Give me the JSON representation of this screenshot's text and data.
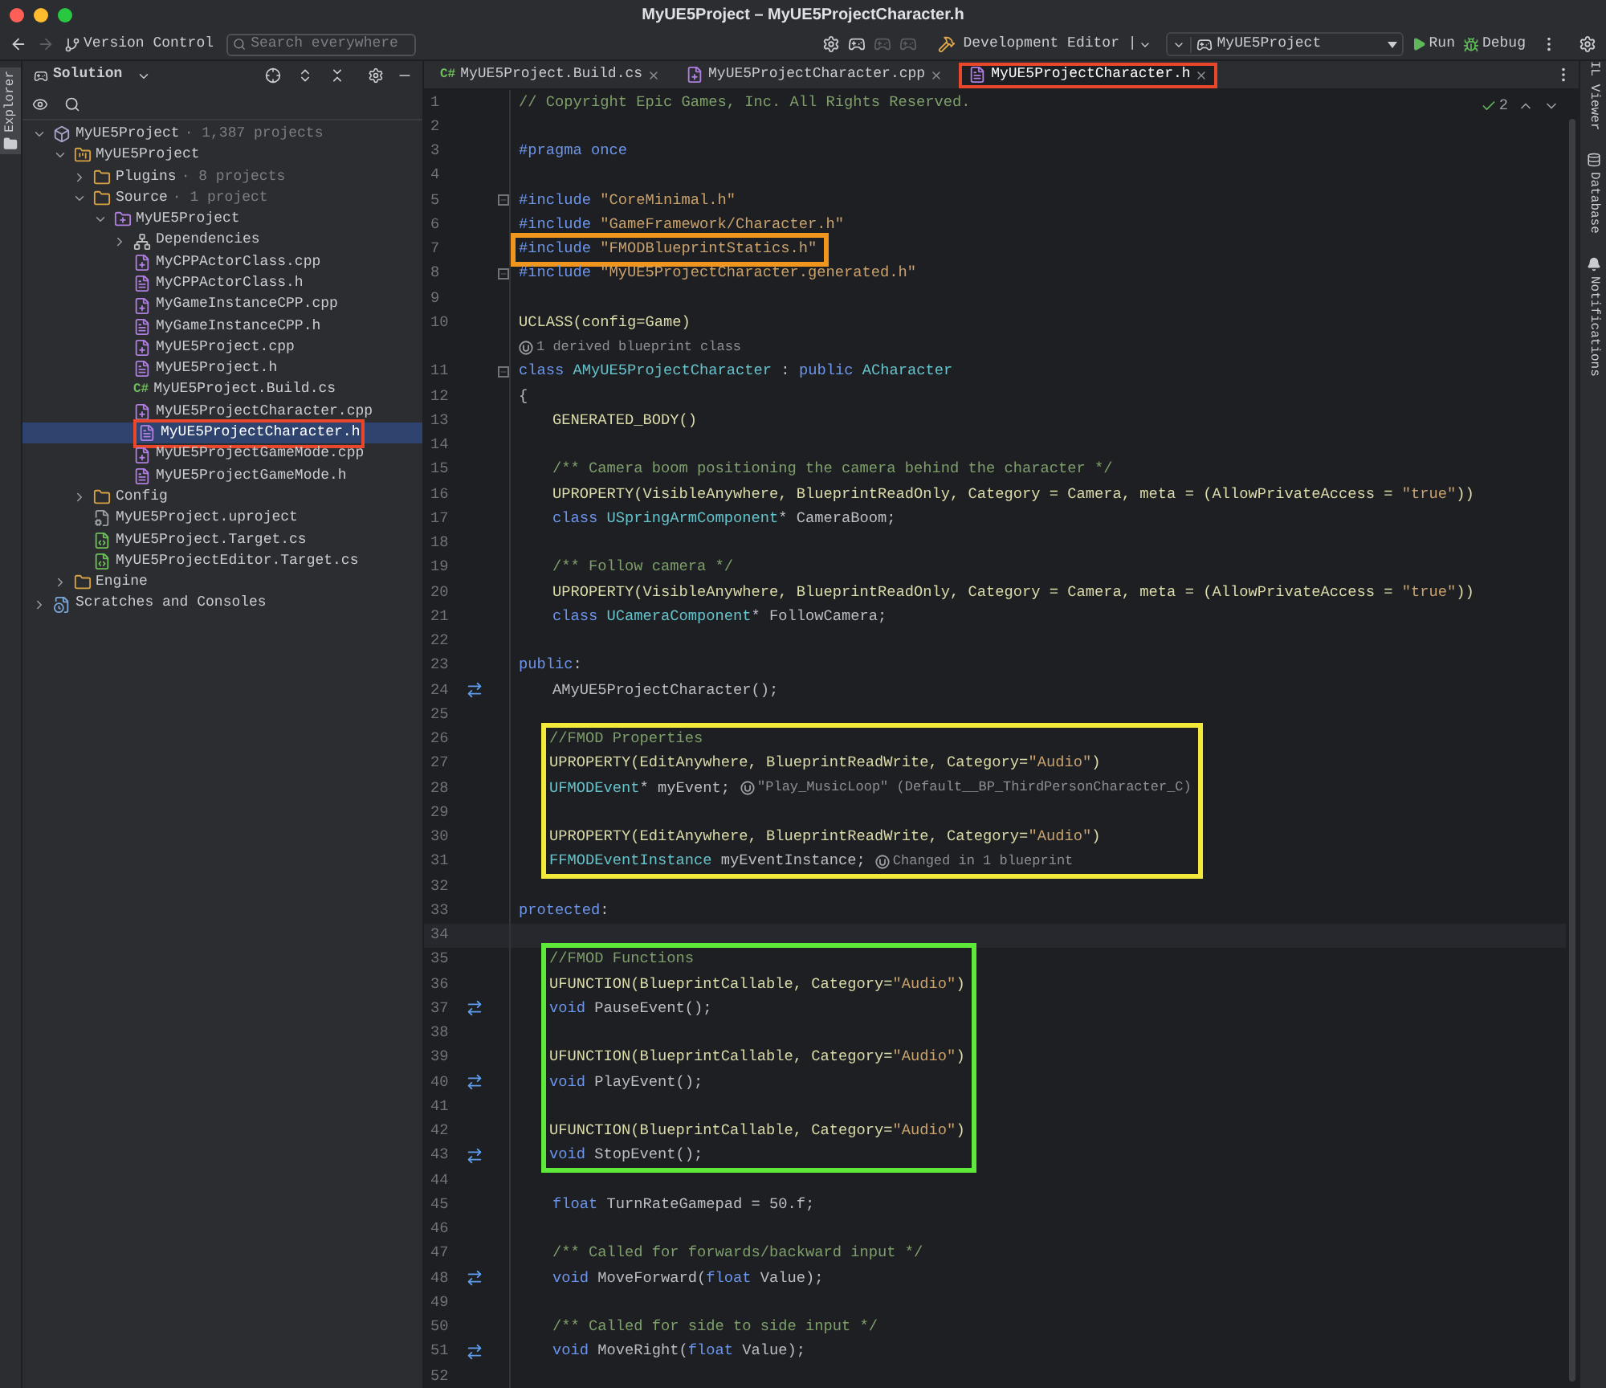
{
  "window": {
    "title": "MyUE5Project – MyUE5ProjectCharacter.h"
  },
  "toolbar": {
    "version_control": "Version Control",
    "search": {
      "placeholder": "Search everywhere"
    },
    "configuration": "Development Editor |",
    "target": "MyUE5Project",
    "run": "Run",
    "debug": "Debug"
  },
  "left_strip": [
    {
      "label": "Explorer",
      "selected": true
    }
  ],
  "right_strip": [
    {
      "kind": "plain",
      "label": "IL Viewer"
    },
    {
      "kind": "database",
      "label": "Database"
    },
    {
      "kind": "bell",
      "label": "Notifications"
    }
  ],
  "sidebar": {
    "header": "Solution",
    "tree": [
      {
        "name": "MyUE5Project",
        "note": "· 1,387 projects",
        "kind": "solution",
        "expanded": true,
        "selected": false,
        "children": [
          {
            "name": "MyUE5Project",
            "kind": "project",
            "expanded": true,
            "selected": false,
            "children": [
              {
                "name": "Plugins",
                "note": "· 8 projects",
                "kind": "folder",
                "expanded": false,
                "selected": false
              },
              {
                "name": "Source",
                "note": "· 1 project",
                "kind": "folder",
                "expanded": true,
                "selected": false,
                "children": [
                  {
                    "name": "MyUE5Project",
                    "kind": "cppproject",
                    "expanded": true,
                    "selected": false,
                    "children": [
                      {
                        "name": "Dependencies",
                        "kind": "deps",
                        "expanded": false,
                        "selected": false
                      },
                      {
                        "name": "MyCPPActorClass.cpp",
                        "kind": "cpp",
                        "selected": false
                      },
                      {
                        "name": "MyCPPActorClass.h",
                        "kind": "h",
                        "selected": false
                      },
                      {
                        "name": "MyGameInstanceCPP.cpp",
                        "kind": "cpp",
                        "selected": false
                      },
                      {
                        "name": "MyGameInstanceCPP.h",
                        "kind": "h",
                        "selected": false
                      },
                      {
                        "name": "MyUE5Project.cpp",
                        "kind": "cpp",
                        "selected": false
                      },
                      {
                        "name": "MyUE5Project.h",
                        "kind": "h",
                        "selected": false
                      },
                      {
                        "name": "MyUE5Project.Build.cs",
                        "kind": "badge",
                        "badge": "C#",
                        "selected": false
                      },
                      {
                        "name": "MyUE5ProjectCharacter.cpp",
                        "kind": "cpp",
                        "selected": false
                      },
                      {
                        "name": "MyUE5ProjectCharacter.h",
                        "kind": "h",
                        "selected": true,
                        "color": "#e8472c"
                      },
                      {
                        "name": "MyUE5ProjectGameMode.cpp",
                        "kind": "cpp",
                        "selected": false
                      },
                      {
                        "name": "MyUE5ProjectGameMode.h",
                        "kind": "h",
                        "selected": false
                      }
                    ]
                  }
                ]
              },
              {
                "name": "Config",
                "kind": "folder",
                "expanded": false,
                "selected": false
              },
              {
                "name": "MyUE5Project.uproject",
                "kind": "uproject",
                "selected": false
              },
              {
                "name": "MyUE5Project.Target.cs",
                "kind": "target",
                "selected": false
              },
              {
                "name": "MyUE5ProjectEditor.Target.cs",
                "kind": "target",
                "selected": false
              }
            ]
          },
          {
            "name": "Engine",
            "kind": "folder",
            "expanded": false,
            "selected": false
          }
        ]
      },
      {
        "name": "Scratches and Consoles",
        "kind": "scratch",
        "expanded": false,
        "selected": false
      }
    ]
  },
  "tabs": [
    {
      "label": "MyUE5Project.Build.cs",
      "kind": "badge",
      "badge": "C#",
      "selected": false
    },
    {
      "label": "MyUE5ProjectCharacter.cpp",
      "kind": "cpp",
      "selected": false
    },
    {
      "label": "MyUE5ProjectCharacter.h",
      "kind": "h",
      "selected": true,
      "color": "#e8472c"
    }
  ],
  "editor": {
    "problems": "2",
    "lines": [
      {
        "kind": "line",
        "number": "1",
        "tokens": [
          {
            "kind": "comment",
            "text": "// Copyright Epic Games, Inc. All Rights Reserved."
          }
        ]
      },
      {
        "kind": "line",
        "number": "2"
      },
      {
        "kind": "line",
        "number": "3",
        "tokens": [
          {
            "kind": "preproc",
            "text": "#pragma once"
          }
        ]
      },
      {
        "kind": "line",
        "number": "4"
      },
      {
        "kind": "line",
        "number": "5",
        "fold": true,
        "tokens": [
          {
            "kind": "preproc",
            "text": "#include "
          },
          {
            "kind": "string",
            "text": "\"CoreMinimal.h\""
          }
        ]
      },
      {
        "kind": "line",
        "number": "6",
        "tokens": [
          {
            "kind": "preproc",
            "text": "#include "
          },
          {
            "kind": "string",
            "text": "\"GameFramework/Character.h\""
          }
        ]
      },
      {
        "kind": "box",
        "color": "#f0961e",
        "lines": [
          {
            "kind": "line",
            "number": "7",
            "tokens": [
              {
                "kind": "preproc",
                "text": "#include "
              },
              {
                "kind": "string",
                "text": "\"FMODBlueprintStatics.h\""
              }
            ]
          }
        ]
      },
      {
        "kind": "line",
        "number": "8",
        "fold": true,
        "tokens": [
          {
            "kind": "preproc",
            "text": "#include "
          },
          {
            "kind": "string",
            "text": "\"MyUE5ProjectCharacter.generated.h\""
          }
        ]
      },
      {
        "kind": "line",
        "number": "9"
      },
      {
        "kind": "line",
        "number": "10",
        "tokens": [
          {
            "kind": "macro",
            "text": "UCLASS(config=Game)"
          }
        ]
      },
      {
        "kind": "hint",
        "text": "1 derived blueprint class"
      },
      {
        "kind": "line",
        "number": "11",
        "fold": true,
        "tokens": [
          {
            "kind": "keyword",
            "text": "class "
          },
          {
            "kind": "type",
            "text": "AMyUE5ProjectCharacter"
          },
          {
            "kind": "plain",
            "text": " : "
          },
          {
            "kind": "keyword",
            "text": "public "
          },
          {
            "kind": "type",
            "text": "ACharacter"
          }
        ]
      },
      {
        "kind": "line",
        "number": "12",
        "tokens": [
          {
            "kind": "plain",
            "text": "{"
          }
        ]
      },
      {
        "kind": "line",
        "number": "13",
        "indented": true,
        "tokens": [
          {
            "kind": "macro",
            "text": "GENERATED_BODY()"
          }
        ]
      },
      {
        "kind": "line",
        "number": "14"
      },
      {
        "kind": "line",
        "number": "15",
        "indented": true,
        "tokens": [
          {
            "kind": "comment",
            "text": "/** Camera boom positioning the camera behind the character */"
          }
        ]
      },
      {
        "kind": "line",
        "number": "16",
        "indented": true,
        "tokens": [
          {
            "kind": "macro",
            "text": "UPROPERTY(VisibleAnywhere, BlueprintReadOnly, Category = Camera, meta = (AllowPrivateAccess = "
          },
          {
            "kind": "string",
            "text": "\"true\""
          },
          {
            "kind": "macro",
            "text": "))"
          }
        ]
      },
      {
        "kind": "line",
        "number": "17",
        "indented": true,
        "tokens": [
          {
            "kind": "keyword",
            "text": "class "
          },
          {
            "kind": "type",
            "text": "USpringArmComponent"
          },
          {
            "kind": "plain",
            "text": "* CameraBoom;"
          }
        ]
      },
      {
        "kind": "line",
        "number": "18"
      },
      {
        "kind": "line",
        "number": "19",
        "indented": true,
        "tokens": [
          {
            "kind": "comment",
            "text": "/** Follow camera */"
          }
        ]
      },
      {
        "kind": "line",
        "number": "20",
        "indented": true,
        "tokens": [
          {
            "kind": "macro",
            "text": "UPROPERTY(VisibleAnywhere, BlueprintReadOnly, Category = Camera, meta = (AllowPrivateAccess = "
          },
          {
            "kind": "string",
            "text": "\"true\""
          },
          {
            "kind": "macro",
            "text": "))"
          }
        ]
      },
      {
        "kind": "line",
        "number": "21",
        "indented": true,
        "tokens": [
          {
            "kind": "keyword",
            "text": "class "
          },
          {
            "kind": "type",
            "text": "UCameraComponent"
          },
          {
            "kind": "plain",
            "text": "* FollowCamera;"
          }
        ]
      },
      {
        "kind": "line",
        "number": "22"
      },
      {
        "kind": "line",
        "number": "23",
        "tokens": [
          {
            "kind": "keyword",
            "text": "public"
          },
          {
            "kind": "plain",
            "text": ":"
          }
        ]
      },
      {
        "kind": "line",
        "number": "24",
        "indented": true,
        "override": true,
        "tokens": [
          {
            "kind": "plain",
            "text": "AMyUE5ProjectCharacter();"
          }
        ]
      },
      {
        "kind": "line",
        "number": "25"
      },
      {
        "kind": "box",
        "color": "#f2e93a",
        "indented": true,
        "lines": [
          {
            "kind": "line",
            "number": "26",
            "tokens": [
              {
                "kind": "comment",
                "text": "//FMOD Properties"
              }
            ]
          },
          {
            "kind": "line",
            "number": "27",
            "tokens": [
              {
                "kind": "macro",
                "text": "UPROPERTY(EditAnywhere, BlueprintReadWrite, Category="
              },
              {
                "kind": "string",
                "text": "\"Audio\""
              },
              {
                "kind": "macro",
                "text": ")"
              }
            ]
          },
          {
            "kind": "line",
            "number": "28",
            "tokens": [
              {
                "kind": "type",
                "text": "UFMODEvent"
              },
              {
                "kind": "plain",
                "text": "* myEvent;"
              }
            ],
            "hint": "\"Play_MusicLoop\" (Default__BP_ThirdPersonCharacter_C)"
          },
          {
            "kind": "line",
            "number": "29"
          },
          {
            "kind": "line",
            "number": "30",
            "tokens": [
              {
                "kind": "macro",
                "text": "UPROPERTY(EditAnywhere, BlueprintReadWrite, Category="
              },
              {
                "kind": "string",
                "text": "\"Audio\""
              },
              {
                "kind": "macro",
                "text": ")"
              }
            ]
          },
          {
            "kind": "line",
            "number": "31",
            "tokens": [
              {
                "kind": "type",
                "text": "FFMODEventInstance"
              },
              {
                "kind": "plain",
                "text": " myEventInstance;"
              }
            ],
            "hint": "Changed in 1 blueprint"
          }
        ]
      },
      {
        "kind": "line",
        "number": "32"
      },
      {
        "kind": "line",
        "number": "33",
        "tokens": [
          {
            "kind": "keyword",
            "text": "protected"
          },
          {
            "kind": "plain",
            "text": ":"
          }
        ]
      },
      {
        "kind": "line",
        "number": "34",
        "current": true
      },
      {
        "kind": "box",
        "color": "#5ee83a",
        "indented": true,
        "lines": [
          {
            "kind": "line",
            "number": "35",
            "tokens": [
              {
                "kind": "comment",
                "text": "//FMOD Functions"
              }
            ]
          },
          {
            "kind": "line",
            "number": "36",
            "tokens": [
              {
                "kind": "macro",
                "text": "UFUNCTION(BlueprintCallable, Category="
              },
              {
                "kind": "string",
                "text": "\"Audio\""
              },
              {
                "kind": "macro",
                "text": ")"
              }
            ]
          },
          {
            "kind": "line",
            "number": "37",
            "override": true,
            "tokens": [
              {
                "kind": "keyword",
                "text": "void "
              },
              {
                "kind": "plain",
                "text": "PauseEvent();"
              }
            ]
          },
          {
            "kind": "line",
            "number": "38"
          },
          {
            "kind": "line",
            "number": "39",
            "tokens": [
              {
                "kind": "macro",
                "text": "UFUNCTION(BlueprintCallable, Category="
              },
              {
                "kind": "string",
                "text": "\"Audio\""
              },
              {
                "kind": "macro",
                "text": ")"
              }
            ]
          },
          {
            "kind": "line",
            "number": "40",
            "override": true,
            "tokens": [
              {
                "kind": "keyword",
                "text": "void "
              },
              {
                "kind": "plain",
                "text": "PlayEvent();"
              }
            ]
          },
          {
            "kind": "line",
            "number": "41"
          },
          {
            "kind": "line",
            "number": "42",
            "tokens": [
              {
                "kind": "macro",
                "text": "UFUNCTION(BlueprintCallable, Category="
              },
              {
                "kind": "string",
                "text": "\"Audio\""
              },
              {
                "kind": "macro",
                "text": ")"
              }
            ]
          },
          {
            "kind": "line",
            "number": "43",
            "override": true,
            "tokens": [
              {
                "kind": "keyword",
                "text": "void "
              },
              {
                "kind": "plain",
                "text": "StopEvent();"
              }
            ]
          }
        ]
      },
      {
        "kind": "line",
        "number": "44"
      },
      {
        "kind": "line",
        "number": "45",
        "indented": true,
        "tokens": [
          {
            "kind": "keyword",
            "text": "float "
          },
          {
            "kind": "plain",
            "text": "TurnRateGamepad = 50.f;"
          }
        ]
      },
      {
        "kind": "line",
        "number": "46"
      },
      {
        "kind": "line",
        "number": "47",
        "indented": true,
        "tokens": [
          {
            "kind": "comment",
            "text": "/** Called for forwards/backward input */"
          }
        ]
      },
      {
        "kind": "line",
        "number": "48",
        "indented": true,
        "override": true,
        "tokens": [
          {
            "kind": "keyword",
            "text": "void "
          },
          {
            "kind": "plain",
            "text": "MoveForward("
          },
          {
            "kind": "keyword",
            "text": "float"
          },
          {
            "kind": "plain",
            "text": " Value);"
          }
        ]
      },
      {
        "kind": "line",
        "number": "49"
      },
      {
        "kind": "line",
        "number": "50",
        "indented": true,
        "tokens": [
          {
            "kind": "comment",
            "text": "/** Called for side to side input */"
          }
        ]
      },
      {
        "kind": "line",
        "number": "51",
        "indented": true,
        "override": true,
        "tokens": [
          {
            "kind": "keyword",
            "text": "void "
          },
          {
            "kind": "plain",
            "text": "MoveRight("
          },
          {
            "kind": "keyword",
            "text": "float"
          },
          {
            "kind": "plain",
            "text": " Value);"
          }
        ]
      },
      {
        "kind": "line",
        "number": "52"
      }
    ]
  }
}
